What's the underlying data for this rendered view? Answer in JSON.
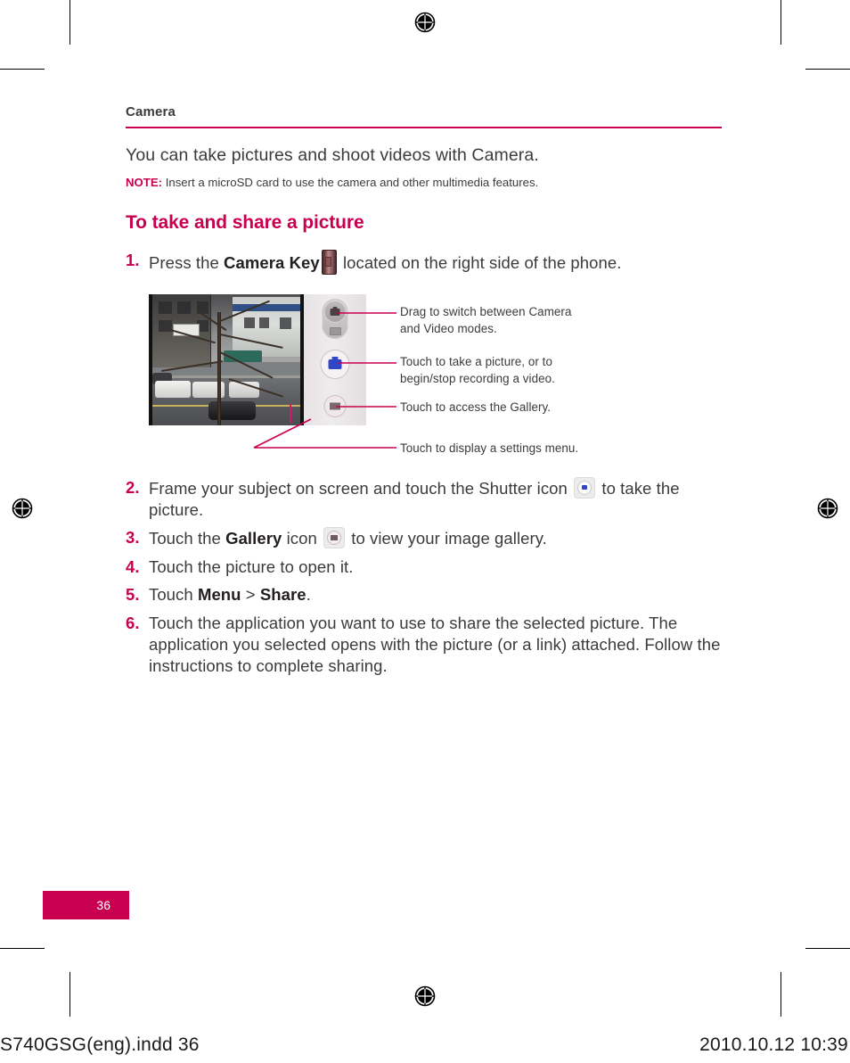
{
  "document": {
    "running_head": "Camera",
    "page_number": "36",
    "imprint_left": "S740GSG(eng).indd   36",
    "imprint_right": "2010.10.12   10:39:"
  },
  "colors": {
    "accent": "#c8004f",
    "body_text": "#3b3b3d",
    "rule": "#c8004f",
    "badge_bg": "#c8004f",
    "badge_text": "#ffffff"
  },
  "body": {
    "intro": "You can take pictures and shoot videos with Camera.",
    "note_label": "NOTE:",
    "note_text": "Insert a microSD card to use the camera and other multimedia features.",
    "section_title": "To take and share a picture"
  },
  "steps": [
    {
      "num": "1.",
      "parts": [
        {
          "type": "text",
          "value": "Press the "
        },
        {
          "type": "bold",
          "value": "Camera Key"
        },
        {
          "type": "icon",
          "value": "camera-key-icon"
        },
        {
          "type": "text",
          "value": " located on the right side of the phone."
        }
      ],
      "plain": "Press the Camera Key located on the right side of the phone."
    },
    {
      "num": "2.",
      "parts": [
        {
          "type": "text",
          "value": "Frame your subject on screen and touch the Shutter icon "
        },
        {
          "type": "icon",
          "value": "shutter-icon"
        },
        {
          "type": "text",
          "value": " to take the picture."
        }
      ],
      "plain": "Frame your subject on screen and touch the Shutter icon to take the picture."
    },
    {
      "num": "3.",
      "parts": [
        {
          "type": "text",
          "value": "Touch the "
        },
        {
          "type": "bold",
          "value": "Gallery"
        },
        {
          "type": "text",
          "value": " icon "
        },
        {
          "type": "icon",
          "value": "gallery-icon"
        },
        {
          "type": "text",
          "value": " to view your image gallery."
        }
      ],
      "plain": "Touch the Gallery icon to view your image gallery."
    },
    {
      "num": "4.",
      "parts": [
        {
          "type": "text",
          "value": "Touch the picture to open it."
        }
      ],
      "plain": "Touch the picture to open it."
    },
    {
      "num": "5.",
      "parts": [
        {
          "type": "text",
          "value": "Touch "
        },
        {
          "type": "bold",
          "value": "Menu"
        },
        {
          "type": "text",
          "value": " > "
        },
        {
          "type": "bold",
          "value": "Share"
        },
        {
          "type": "text",
          "value": "."
        }
      ],
      "plain": "Touch Menu > Share."
    },
    {
      "num": "6.",
      "parts": [
        {
          "type": "text",
          "value": "Touch the application you want to use to share the selected picture. The application you selected opens with the picture (or a link) attached. Follow the instructions to complete sharing."
        }
      ],
      "plain": "Touch the application you want to use to share the selected picture. The application you selected opens with the picture (or a link) attached. Follow the instructions to complete sharing."
    }
  ],
  "step_texts": {
    "s1_a": "Press the ",
    "s1_bold": "Camera Key",
    "s1_b": " located on the right side of the phone.",
    "s2_a": "Frame your subject on screen and touch the Shutter icon ",
    "s2_b": " to take the picture.",
    "s3_a": "Touch the ",
    "s3_bold": "Gallery",
    "s3_mid": " icon ",
    "s3_b": " to view your image gallery.",
    "s4": "Touch the picture to open it.",
    "s5_a": "Touch ",
    "s5_bold1": "Menu",
    "s5_gt": " > ",
    "s5_bold2": "Share",
    "s5_end": ".",
    "s6": "Touch the application you want to use to share the selected picture. The application you selected opens with the picture (or a link) attached. Follow the instructions to complete sharing."
  },
  "figure": {
    "alt": "Camera viewfinder screen with on-screen controls",
    "callouts": [
      {
        "id": "mode-switch",
        "line1": "Drag to switch between Camera",
        "line2": "and Video modes."
      },
      {
        "id": "shutter",
        "line1": "Touch to take a picture, or to",
        "line2": "begin/stop recording a video."
      },
      {
        "id": "gallery",
        "line1": "Touch to access the Gallery.",
        "line2": ""
      },
      {
        "id": "settings",
        "line1": "Touch to display a settings menu.",
        "line2": ""
      }
    ],
    "controls": [
      {
        "id": "mode-toggle",
        "icon": "camera-video-toggle-icon"
      },
      {
        "id": "shutter-button",
        "icon": "shutter-icon"
      },
      {
        "id": "gallery-button",
        "icon": "gallery-icon"
      }
    ]
  },
  "print_marks": {
    "registration_icon": "registration-target-icon",
    "count": "5"
  }
}
